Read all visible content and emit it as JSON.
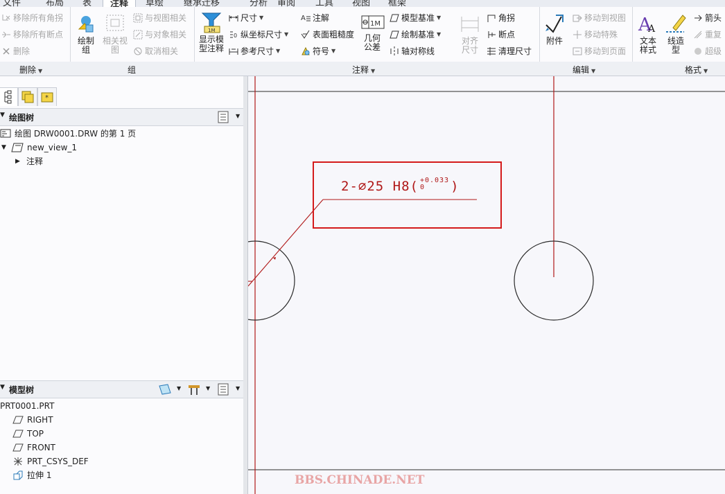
{
  "tabs": [
    "文件",
    "布局",
    "表",
    "注释",
    "草绘",
    "继承迁移",
    "分析",
    "审阅",
    "工具",
    "视图",
    "框架"
  ],
  "ribbon": {
    "delete_group": {
      "remove_all_corners": "移除所有角拐",
      "remove_all_breakpoints": "移除所有断点",
      "delete": "删除",
      "label": "删除"
    },
    "group_group": {
      "draw_group": "绘制\n组",
      "related_view": "相关视\n图",
      "view_related": "与视图相关",
      "object_related": "与对象相关",
      "unrelate": "取消相关",
      "label": "组"
    },
    "annotation_group": {
      "show_model_annotation": "显示模\n型注释",
      "dimension": "尺寸",
      "ordinate_dimension": "纵坐标尺寸",
      "reference_dimension": "参考尺寸",
      "note": "注解",
      "surface_roughness": "表面粗糙度",
      "symbol": "符号",
      "geometric_tolerance": "几何\n公差",
      "model_datum": "模型基准",
      "draw_datum": "绘制基准",
      "axis_symmetry": "轴对称线",
      "align_dimension": "对齐\n尺寸",
      "corner": "角拐",
      "breakpoint": "断点",
      "clean_dimension": "清理尺寸",
      "label": "注释"
    },
    "edit_group": {
      "attachment": "附件",
      "move_to_view": "移动到视图",
      "move_special": "移动特殊",
      "move_to_page": "移动到页面",
      "label": "编辑"
    },
    "format_group": {
      "text_style": "文本\n样式",
      "line_style": "线造\n型",
      "arrow": "箭头",
      "repeat": "重复",
      "hyperlink": "超级",
      "label": "格式"
    }
  },
  "drawing_tree": {
    "title": "绘图树",
    "items": [
      "绘图 DRW0001.DRW 的第 1 页",
      "new_view_1",
      "注释"
    ]
  },
  "model_tree": {
    "title": "模型树",
    "items": [
      "PRT0001.PRT",
      "RIGHT",
      "TOP",
      "FRONT",
      "PRT_CSYS_DEF",
      "拉伸 1"
    ]
  },
  "canvas": {
    "annotation_main": "2-∅25 H8(",
    "tol_upper": "+0.033",
    "tol_lower": "0",
    "annotation_close": ")",
    "watermark": "BBS.CHINADE.NET"
  },
  "colors": {
    "drawing_line": "#b01818",
    "highlight_box": "#d41a1a",
    "geometry": "#2a2a2a"
  }
}
